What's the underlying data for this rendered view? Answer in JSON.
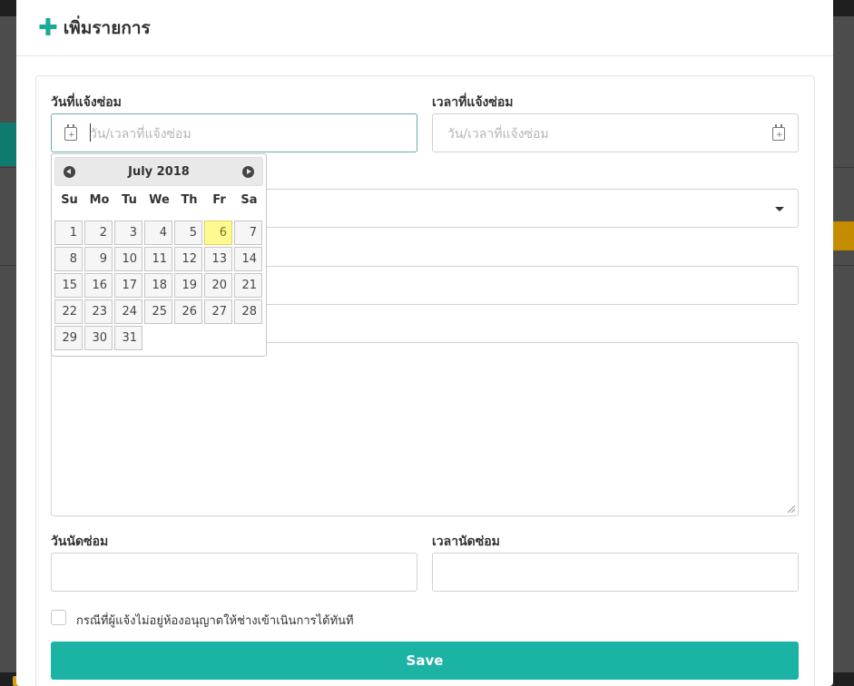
{
  "modal": {
    "title": "เพิ่มรายการ",
    "plus_icon": "plus-icon"
  },
  "form": {
    "report_date": {
      "label": "วันที่แจ้งซ่อม",
      "placeholder": "วัน/เวลาที่แจ้งซ่อม",
      "icon": "calendar-icon"
    },
    "report_time": {
      "label": "เวลาที่แจ้งซ่อม",
      "placeholder": "วัน/เวลาที่แจ้งซ่อม",
      "icon": "calendar-icon"
    },
    "appointment_date": {
      "label": "วันนัดซ่อม",
      "value": ""
    },
    "appointment_time": {
      "label": "เวลานัดซ่อม",
      "value": ""
    },
    "select_field": {
      "value": ""
    },
    "text_field": {
      "value": ""
    },
    "textarea": {
      "value": ""
    },
    "permission_checkbox": {
      "label": "กรณีที่ผู้แจ้งไม่อยู่ห้องอนุญาตให้ช่างเข้าเนินการได้ทันที",
      "checked": false
    },
    "save_label": "Save"
  },
  "datepicker": {
    "month_label": "July 2018",
    "days_of_week": [
      "Su",
      "Mo",
      "Tu",
      "We",
      "Th",
      "Fr",
      "Sa"
    ],
    "first_weekday_offset": 0,
    "days": [
      "1",
      "2",
      "3",
      "4",
      "5",
      "6",
      "7",
      "8",
      "9",
      "10",
      "11",
      "12",
      "13",
      "14",
      "15",
      "16",
      "17",
      "18",
      "19",
      "20",
      "21",
      "22",
      "23",
      "24",
      "25",
      "26",
      "27",
      "28",
      "29",
      "30",
      "31"
    ],
    "today": "6"
  },
  "colors": {
    "accent": "#1bb3a4",
    "today_highlight": "#fffa90",
    "backdrop": "#4c4c4c"
  }
}
